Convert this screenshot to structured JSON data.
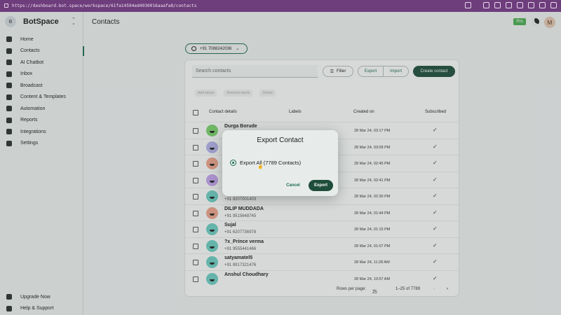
{
  "browser": {
    "url": "https://dashboard.bot.space/workspace/61fa14594ed4930016aaafa8/contacts"
  },
  "brand": {
    "avatar_letter": "B",
    "name": "BotSpace"
  },
  "sidebar": {
    "items": [
      {
        "label": "Home",
        "icon": "home-icon"
      },
      {
        "label": "Contacts",
        "icon": "contacts-icon"
      },
      {
        "label": "AI Chatbot",
        "icon": "ai-chatbot-icon"
      },
      {
        "label": "Inbox",
        "icon": "inbox-icon"
      },
      {
        "label": "Broadcast",
        "icon": "broadcast-icon"
      },
      {
        "label": "Content & Templates",
        "icon": "templates-icon"
      },
      {
        "label": "Automation",
        "icon": "automation-icon"
      },
      {
        "label": "Reports",
        "icon": "reports-icon"
      },
      {
        "label": "Integrations",
        "icon": "integrations-icon"
      },
      {
        "label": "Settings",
        "icon": "settings-icon"
      }
    ],
    "bottom": [
      {
        "label": "Upgrade Now",
        "icon": "upgrade-icon"
      },
      {
        "label": "Help & Support",
        "icon": "help-icon"
      }
    ],
    "active": "Contacts"
  },
  "header": {
    "title": "Contacts",
    "badge": "Pro",
    "user_initial": "M"
  },
  "number_selector": {
    "value": "+91 7088242036"
  },
  "toolbar": {
    "search_placeholder": "Search contacts",
    "filter_label": "Filter",
    "export_label": "Export",
    "import_label": "Import",
    "create_label": "Create contact"
  },
  "bulk_actions": [
    "Add labels",
    "Remove labels",
    "Delete"
  ],
  "table": {
    "columns": [
      "Contact details",
      "Labels",
      "Created on",
      "Subscribed"
    ],
    "rows": [
      {
        "name": "Durga Borude",
        "phone": "",
        "created": "28 Mar 24, 03:17 PM",
        "subscribed": "✓"
      },
      {
        "name": "",
        "phone": "",
        "created": "28 Mar 24, 03:09 PM",
        "subscribed": "✓"
      },
      {
        "name": "",
        "phone": "",
        "created": "28 Mar 24, 02:45 PM",
        "subscribed": "✓"
      },
      {
        "name": "",
        "phone": "",
        "created": "28 Mar 24, 02:41 PM",
        "subscribed": "✓"
      },
      {
        "name": "",
        "phone": "+91 8207001403",
        "created": "28 Mar 24, 02:30 PM",
        "subscribed": "✓"
      },
      {
        "name": "DILIP MUDDADA",
        "phone": "+91 9515648745",
        "created": "28 Mar 24, 01:44 PM",
        "subscribed": "✓"
      },
      {
        "name": "Sujal",
        "phone": "+91 6207736978",
        "created": "28 Mar 24, 01:15 PM",
        "subscribed": "✓"
      },
      {
        "name": "?x_Prince verma",
        "phone": "+91 9555441466",
        "created": "28 Mar 24, 01:07 PM",
        "subscribed": "✓"
      },
      {
        "name": "satyamatel5",
        "phone": "+91 8917321476",
        "created": "28 Mar 24, 11:28 AM",
        "subscribed": "✓"
      },
      {
        "name": "Anshul Choudhary",
        "phone": "",
        "created": "28 Mar 24, 10:57 AM",
        "subscribed": "✓"
      }
    ]
  },
  "pager": {
    "rows_per_page_label": "Rows per page:",
    "rows_per_page": "25",
    "range": "1–25 of 7789"
  },
  "modal": {
    "title": "Export Contact",
    "option_label": "Export All (7789 Contacts)",
    "cancel_label": "Cancel",
    "export_label": "Export"
  },
  "colors": {
    "primary": "#1e4d3b",
    "accent": "#1e6b53",
    "browser": "#6e3d7c"
  }
}
